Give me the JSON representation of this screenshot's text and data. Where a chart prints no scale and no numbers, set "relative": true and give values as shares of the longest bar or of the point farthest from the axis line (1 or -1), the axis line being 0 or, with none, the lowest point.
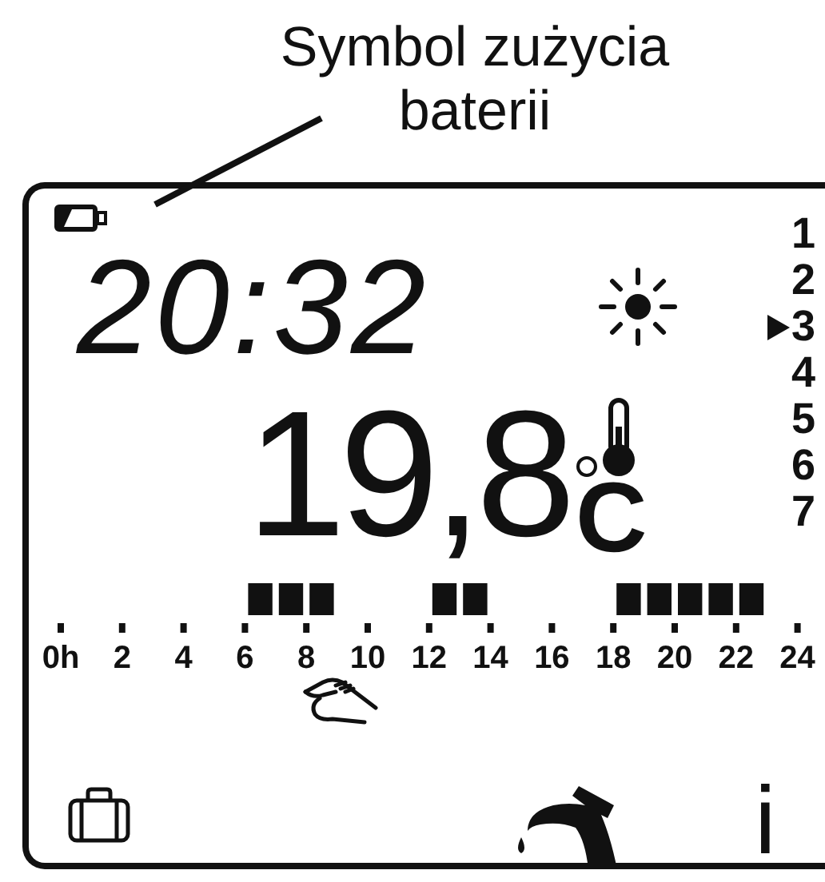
{
  "caption": "Symbol zużycia baterii",
  "display": {
    "battery_low": true,
    "time": "20:32",
    "temperature": "19,8",
    "temperature_unit": "C",
    "days": [
      {
        "label": "1",
        "selected": false
      },
      {
        "label": "2",
        "selected": false
      },
      {
        "label": "3",
        "selected": true
      },
      {
        "label": "4",
        "selected": false
      },
      {
        "label": "5",
        "selected": false
      },
      {
        "label": "6",
        "selected": false
      },
      {
        "label": "7",
        "selected": false
      }
    ],
    "schedule": {
      "chart_data": {
        "type": "bar",
        "x": [
          0.5,
          1.5,
          2.5,
          3.5,
          4.5,
          5.5,
          6.5,
          7.5,
          8.5,
          9.5,
          10.5,
          11.5,
          12.5,
          13.5,
          14.5,
          15.5,
          16.5,
          17.5,
          18.5,
          19.5,
          20.5,
          21.5,
          22.5,
          23.5
        ],
        "values": [
          0,
          0,
          0,
          0,
          0,
          0,
          1,
          1,
          1,
          0,
          0,
          0,
          1,
          1,
          0,
          0,
          0,
          0,
          1,
          1,
          1,
          1,
          1,
          0
        ],
        "xlim": [
          0,
          24
        ],
        "relative": true,
        "xticks": [
          {
            "value": 0,
            "label": "0h"
          },
          {
            "value": 2,
            "label": "2"
          },
          {
            "value": 4,
            "label": "4"
          },
          {
            "value": 6,
            "label": "6"
          },
          {
            "value": 8,
            "label": "8"
          },
          {
            "value": 10,
            "label": "10"
          },
          {
            "value": 12,
            "label": "12"
          },
          {
            "value": 14,
            "label": "14"
          },
          {
            "value": 16,
            "label": "16"
          },
          {
            "value": 18,
            "label": "18"
          },
          {
            "value": 20,
            "label": "20"
          },
          {
            "value": 22,
            "label": "22"
          },
          {
            "value": 24,
            "label": "24"
          }
        ]
      }
    },
    "info_symbol": "i"
  }
}
